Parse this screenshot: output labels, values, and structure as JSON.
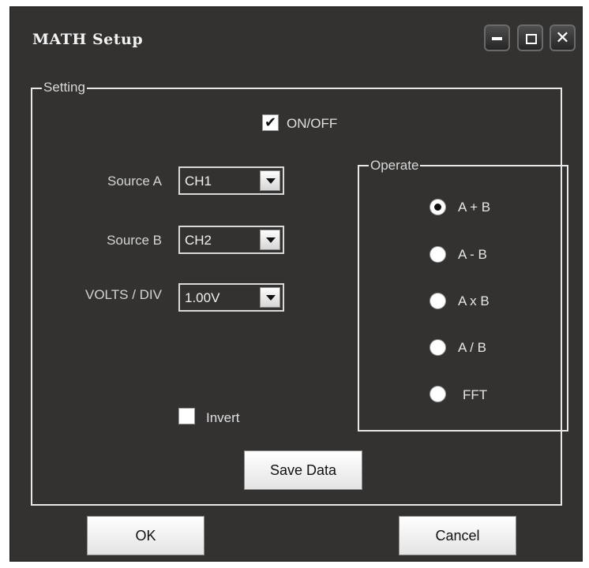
{
  "window": {
    "title": "MATH Setup"
  },
  "titlebar_buttons": {
    "minimize": "minimize",
    "maximize": "maximize",
    "close": "✕"
  },
  "setting": {
    "group_label": "Setting",
    "onoff": {
      "label": "ON/OFF",
      "checked": true,
      "mark": "✔"
    },
    "source_a": {
      "label": "Source A",
      "value": "CH1"
    },
    "source_b": {
      "label": "Source B",
      "value": "CH2"
    },
    "volts_div": {
      "label": "VOLTS / DIV",
      "value": "1.00V"
    },
    "invert": {
      "label": "Invert",
      "checked": false
    },
    "save_data": "Save Data"
  },
  "operate": {
    "group_label": "Operate",
    "options": [
      {
        "label": "A + B",
        "selected": true
      },
      {
        "label": "A -  B",
        "selected": false
      },
      {
        "label": "A x B",
        "selected": false
      },
      {
        "label": "A /  B",
        "selected": false
      },
      {
        "label": "FFT",
        "selected": false
      }
    ]
  },
  "footer": {
    "ok": "OK",
    "cancel": "Cancel"
  },
  "colors": {
    "window_bg": "#333231",
    "text": "#d4d4d4",
    "border": "#e8e8e8"
  }
}
